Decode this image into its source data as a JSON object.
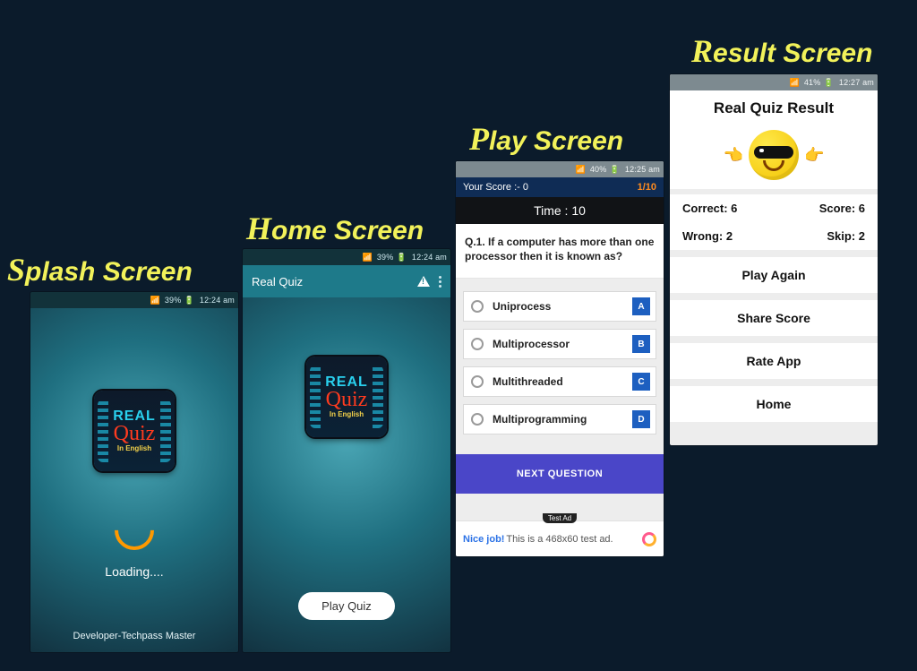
{
  "titles": {
    "splash": "Splash Screen",
    "home": "Home Screen",
    "play": "Play Screen",
    "result": "Result Screen"
  },
  "logo": {
    "line1": "REAL",
    "line2": "Quiz",
    "line3": "In\nEnglish"
  },
  "splash": {
    "status": {
      "battery": "39%",
      "time": "12:24 am"
    },
    "loading": "Loading....",
    "developer": "Developer-Techpass Master"
  },
  "home": {
    "status": {
      "battery": "39%",
      "time": "12:24 am"
    },
    "appTitle": "Real Quiz",
    "playButton": "Play Quiz"
  },
  "play": {
    "status": {
      "battery": "40%",
      "time": "12:25 am"
    },
    "scoreLabel": "Your Score :- 0",
    "progress": "1/10",
    "time": "Time : 10",
    "question": "Q.1. If a computer has more than one processor then it is known as?",
    "options": [
      {
        "label": "Uniprocess",
        "badge": "A"
      },
      {
        "label": "Multiprocessor",
        "badge": "B"
      },
      {
        "label": "Multithreaded",
        "badge": "C"
      },
      {
        "label": "Multiprogramming",
        "badge": "D"
      }
    ],
    "next": "NEXT QUESTION",
    "ad": {
      "tag": "Test Ad",
      "nice": "Nice job!",
      "text": "This is a 468x60 test ad."
    }
  },
  "result": {
    "status": {
      "battery": "41%",
      "time": "12:27 am"
    },
    "title": "Real Quiz Result",
    "correct": "Correct: 6",
    "score": "Score: 6",
    "wrong": "Wrong: 2",
    "skip": "Skip: 2",
    "buttons": [
      "Play Again",
      "Share Score",
      "Rate App",
      "Home"
    ]
  }
}
